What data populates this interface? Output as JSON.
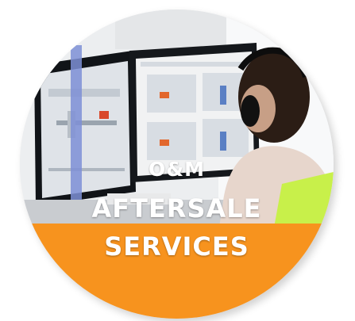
{
  "badge": {
    "title_line1": "O&M",
    "title_line2": "AFTERSALE",
    "title_line3": "SERVICES",
    "band_color": "#f7931e",
    "text_color": "#ffffff"
  }
}
